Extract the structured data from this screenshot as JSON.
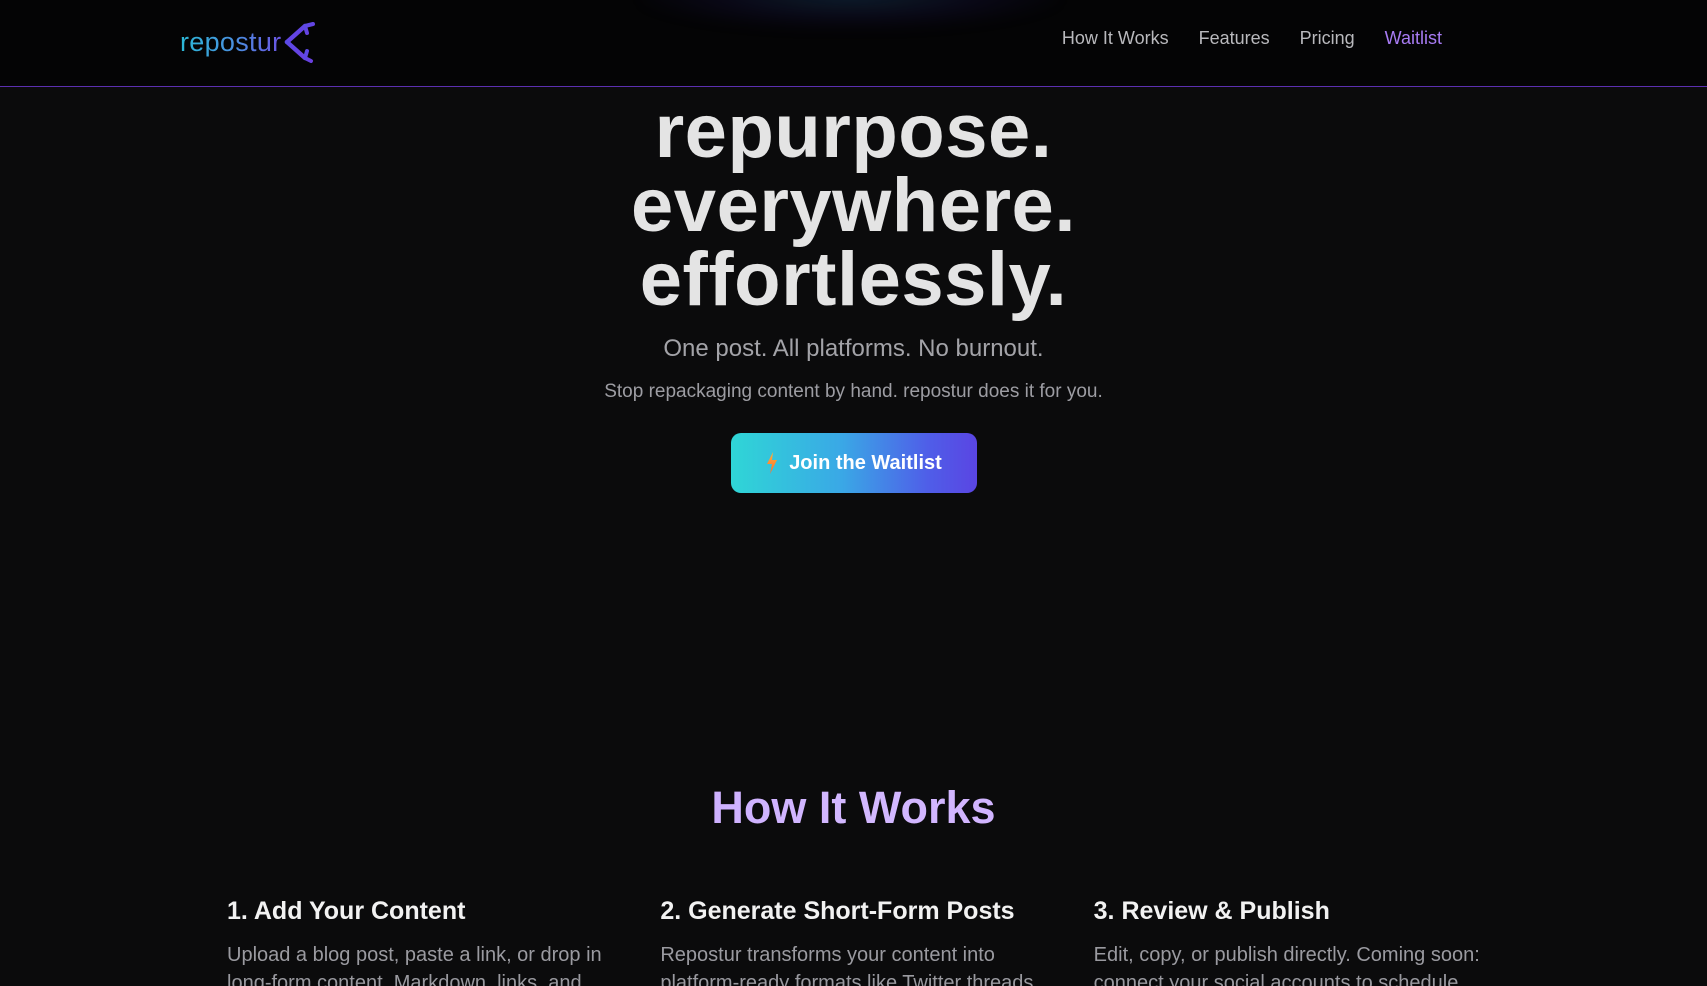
{
  "header": {
    "logo_text": "repostur",
    "logo_icon": "repost-arrows-icon",
    "nav": [
      {
        "label": "How It Works"
      },
      {
        "label": "Features"
      },
      {
        "label": "Pricing"
      },
      {
        "label": "Waitlist",
        "active": true
      }
    ]
  },
  "hero": {
    "headline": [
      "repurpose.",
      "everywhere.",
      "effortlessly."
    ],
    "tagline": "One post. All platforms. No burnout.",
    "subtagline": "Stop repackaging content by hand. repostur does it for you.",
    "cta_label": "Join the Waitlist",
    "cta_icon": "lightning-bolt-icon"
  },
  "how_it_works": {
    "title": "How It Works",
    "steps": [
      {
        "title": "1. Add Your Content",
        "text": "Upload a blog post, paste a link, or drop in long-form content. Markdown, links, and"
      },
      {
        "title": "2. Generate Short-Form Posts",
        "text": "Repostur transforms your content into platform-ready formats like Twitter threads,"
      },
      {
        "title": "3. Review & Publish",
        "text": "Edit, copy, or publish directly. Coming soon: connect your social accounts to schedule"
      }
    ]
  },
  "colors": {
    "background": "#0b0b0c",
    "header_border": "#5b2fb0",
    "nav_active": "#a77bf3",
    "cta_gradient_start": "#2fd6d6",
    "cta_gradient_end": "#5a45e3",
    "section_title": "#c9a6ff"
  }
}
